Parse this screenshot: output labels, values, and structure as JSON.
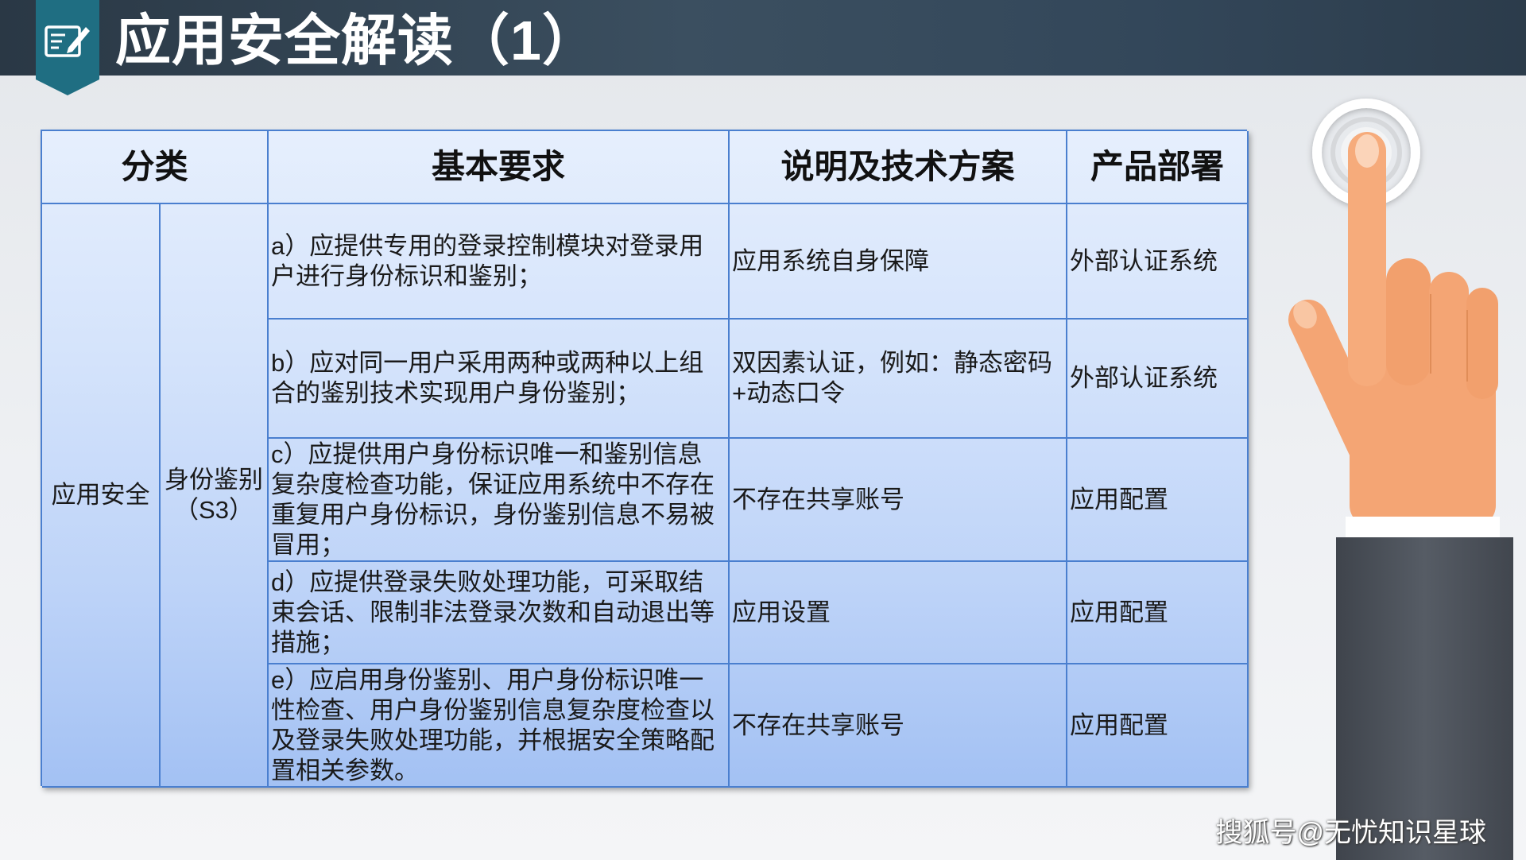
{
  "slide": {
    "title": "应用安全解读（1）",
    "title_icon": "edit-note-icon"
  },
  "table": {
    "headers": {
      "category": "分类",
      "requirement": "基本要求",
      "solution": "说明及技术方案",
      "deployment": "产品部署"
    },
    "category": "应用安全",
    "subcategory": {
      "name": "身份鉴别",
      "code": "（S3）"
    },
    "rows": [
      {
        "requirement": "a）应提供专用的登录控制模块对登录用户进行身份标识和鉴别；",
        "solution": "应用系统自身保障",
        "deployment": "外部认证系统"
      },
      {
        "requirement": "b）应对同一用户采用两种或两种以上组合的鉴别技术实现用户身份鉴别；",
        "solution": "双因素认证，例如：静态密码+动态口令",
        "deployment": "外部认证系统"
      },
      {
        "requirement": "c）应提供用户身份标识唯一和鉴别信息复杂度检查功能，保证应用系统中不存在重复用户身份标识，身份鉴别信息不易被冒用；",
        "solution": "不存在共享账号",
        "deployment": "应用配置"
      },
      {
        "requirement": "d）应提供登录失败处理功能，可采取结束会话、限制非法登录次数和自动退出等措施；",
        "solution": "应用设置",
        "deployment": "应用配置"
      },
      {
        "requirement": "e）应启用身份鉴别、用户身份标识唯一性检查、用户身份鉴别信息复杂度检查以及登录失败处理功能，并根据安全策略配置相关参数。",
        "solution": "不存在共享账号",
        "deployment": "应用配置"
      }
    ]
  },
  "illustration": {
    "icon": "pointing-hand-icon"
  },
  "watermark": "搜狐号@无忧知识星球",
  "colors": {
    "header_band": "#34495a",
    "title_icon_bg": "#1f6e82",
    "table_border": "#4a7fcf",
    "table_top": "#e6effd",
    "table_bottom": "#a3c1f3",
    "skin": "#f4a574",
    "sleeve": "#4b5159"
  }
}
